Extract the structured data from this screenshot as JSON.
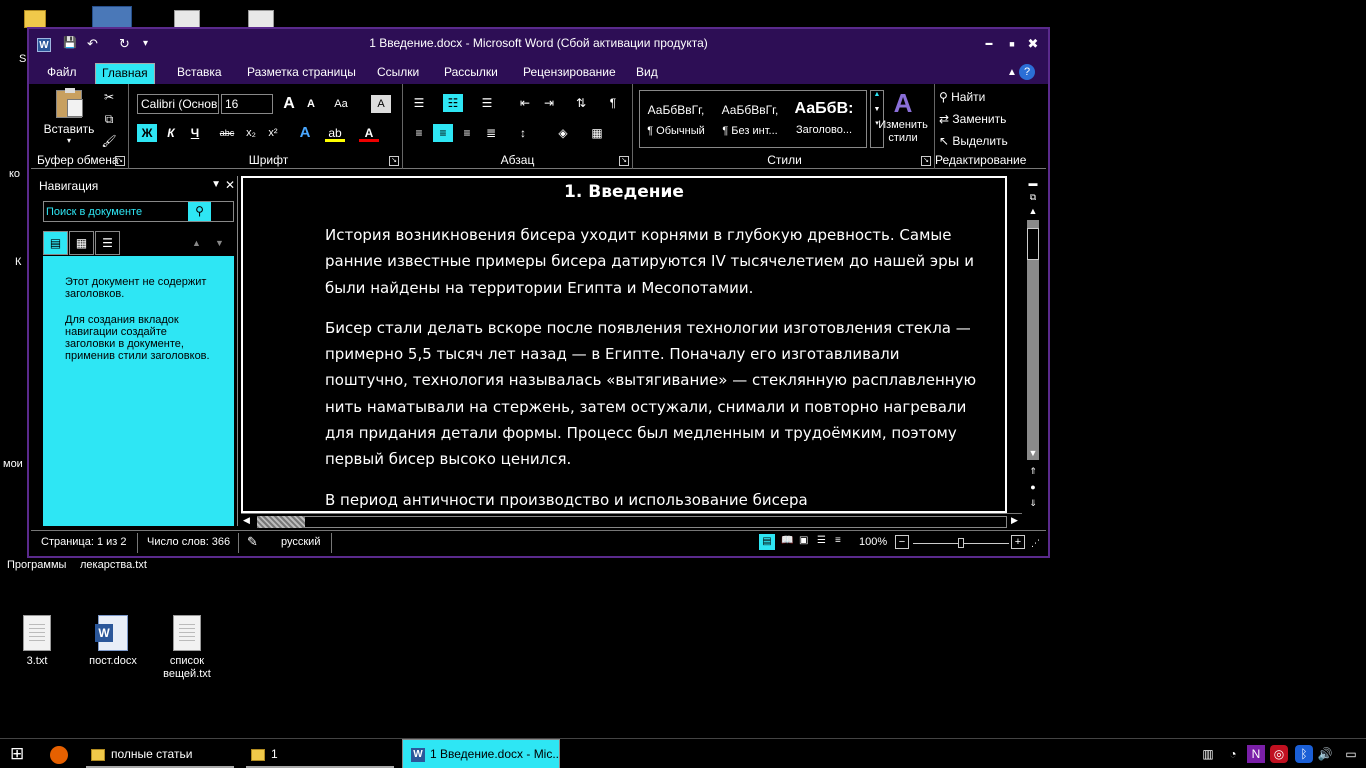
{
  "desktop": {
    "icons": [
      {
        "label": "3.txt",
        "kind": "file"
      },
      {
        "label": "пост.docx",
        "kind": "word"
      },
      {
        "label": "список вещей.txt",
        "kind": "file"
      }
    ],
    "partial_labels": {
      "programs": "Программы",
      "lekarstva": "лекарства.txt",
      "left1": "S",
      "left2": "ко",
      "left3": "К",
      "left4": "мои"
    }
  },
  "window": {
    "title": "1 Введение.docx - Microsoft Word (Сбой активации продукта)",
    "word_icon": "W",
    "qat": {
      "save_icon": "💾",
      "undo_icon": "↶",
      "redo_icon": "↻",
      "customize_icon": "▾"
    },
    "controls": {
      "minimize": "▬",
      "maximize": "■",
      "close": "✖"
    }
  },
  "tabs": [
    {
      "label": "Файл"
    },
    {
      "label": "Главная",
      "active": true
    },
    {
      "label": "Вставка"
    },
    {
      "label": "Разметка страницы"
    },
    {
      "label": "Ссылки"
    },
    {
      "label": "Рассылки"
    },
    {
      "label": "Рецензирование"
    },
    {
      "label": "Вид"
    }
  ],
  "ribbon": {
    "clipboard": {
      "paste_label": "Вставить",
      "group_label": "Буфер обмена"
    },
    "font": {
      "font_name": "Calibri (Основн",
      "font_size": "16",
      "group_label": "Шрифт",
      "bold": "Ж",
      "italic": "К",
      "underline": "Ч"
    },
    "paragraph": {
      "group_label": "Абзац"
    },
    "styles": {
      "items": [
        {
          "sample": "АаБбВвГг,",
          "name": "¶ Обычный"
        },
        {
          "sample": "АаБбВвГг,",
          "name": "¶ Без инт..."
        },
        {
          "sample": "АаБбВ:",
          "name": "Заголово..."
        }
      ],
      "change_styles_label": "Изменить стили",
      "group_label": "Стили"
    },
    "editing": {
      "find": "Найти",
      "replace": "Заменить",
      "select": "Выделить",
      "group_label": "Редактирование"
    }
  },
  "navigation": {
    "title": "Навигация",
    "search_placeholder": "Поиск в документе",
    "body_line1": "Этот документ не содержит заголовков.",
    "body_line2": "Для создания вкладок навигации создайте заголовки в документе, применив стили заголовков."
  },
  "document": {
    "heading": "1.  Введение",
    "paragraphs": [
      "История возникновения бисера уходит корнями в глубокую древность. Самые ранние известные примеры бисера датируются IV тысячелетием до нашей эры и были найдены на территории Египта и Месопотамии.",
      "Бисер стали делать вскоре после появления технологии изготовления стекла — примерно 5,5 тысяч лет назад — в Египте. Поначалу его изготавливали поштучно, технология называлась «вытягивание» — стеклянную расплавленную нить наматывали на стержень, затем остужали, снимали и повторно нагревали для придания детали формы. Процесс был медленным и трудоёмким, поэтому первый бисер высоко ценился.",
      "В период античности производство и использование бисера"
    ]
  },
  "status": {
    "page": "Страница: 1 из 2",
    "words": "Число слов: 366",
    "language": "русский",
    "zoom": "100%"
  },
  "taskbar": {
    "items": [
      {
        "label": "полные статьи"
      },
      {
        "label": "1"
      },
      {
        "label": "1 Введение.docx - Mic...",
        "active": true
      }
    ]
  },
  "colors": {
    "accent": "#2ee6f4",
    "title_bar": "#2d0e55",
    "word_blue": "#2b579a"
  }
}
